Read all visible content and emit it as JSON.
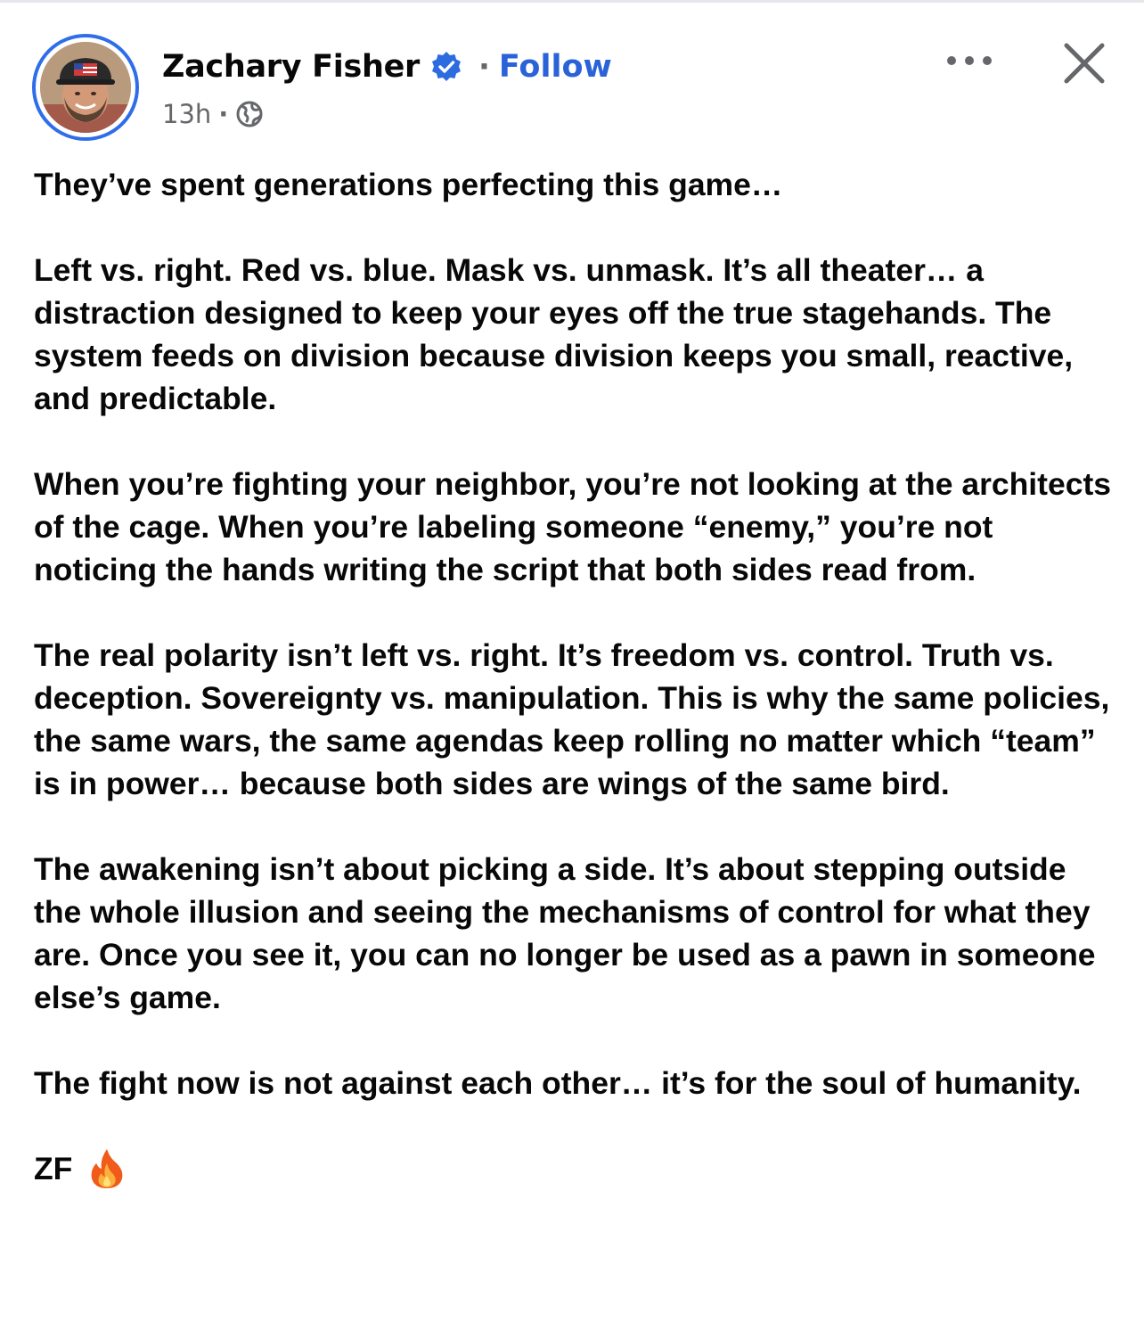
{
  "post": {
    "author": {
      "name": "Zachary Fisher",
      "verified": true,
      "avatar_icon": "avatar-photo"
    },
    "follow_label": "Follow",
    "separator": "·",
    "timestamp": "13h",
    "audience_icon": "globe-icon",
    "menu_icon": "more-options-icon",
    "close_icon": "close-icon",
    "paragraphs": [
      "They’ve spent generations perfecting this game…",
      "Left vs. right. Red vs. blue. Mask vs. unmask. It’s all theater… a distraction designed to keep your eyes off the true stagehands. The system feeds on division because division keeps you small, reactive, and predictable.",
      "When you’re fighting your neighbor, you’re not looking at the architects of the cage. When you’re labeling someone “enemy,” you’re not noticing the hands writing the script that both sides read from.",
      "The real polarity isn’t left vs. right. It’s freedom vs. control. Truth vs. deception. Sovereignty vs. manipulation. This is why the same policies, the same wars, the same agendas keep rolling no matter which “team” is in power… because both sides are wings of the same bird.",
      "The awakening isn’t about picking a side. It’s about stepping outside the whole illusion and seeing the mechanisms of control for what they are. Once you see it, you can no longer be used as a pawn in someone else’s game.",
      "The fight now is not against each other… it’s for the soul of humanity."
    ],
    "signature": "ZF",
    "signature_emoji": "fire-emoji"
  },
  "colors": {
    "link_blue": "#2a62d8",
    "avatar_ring": "#2f6ee8",
    "verified_badge": "#2d6cdf",
    "meta_gray": "#65676b",
    "text": "#080809"
  }
}
